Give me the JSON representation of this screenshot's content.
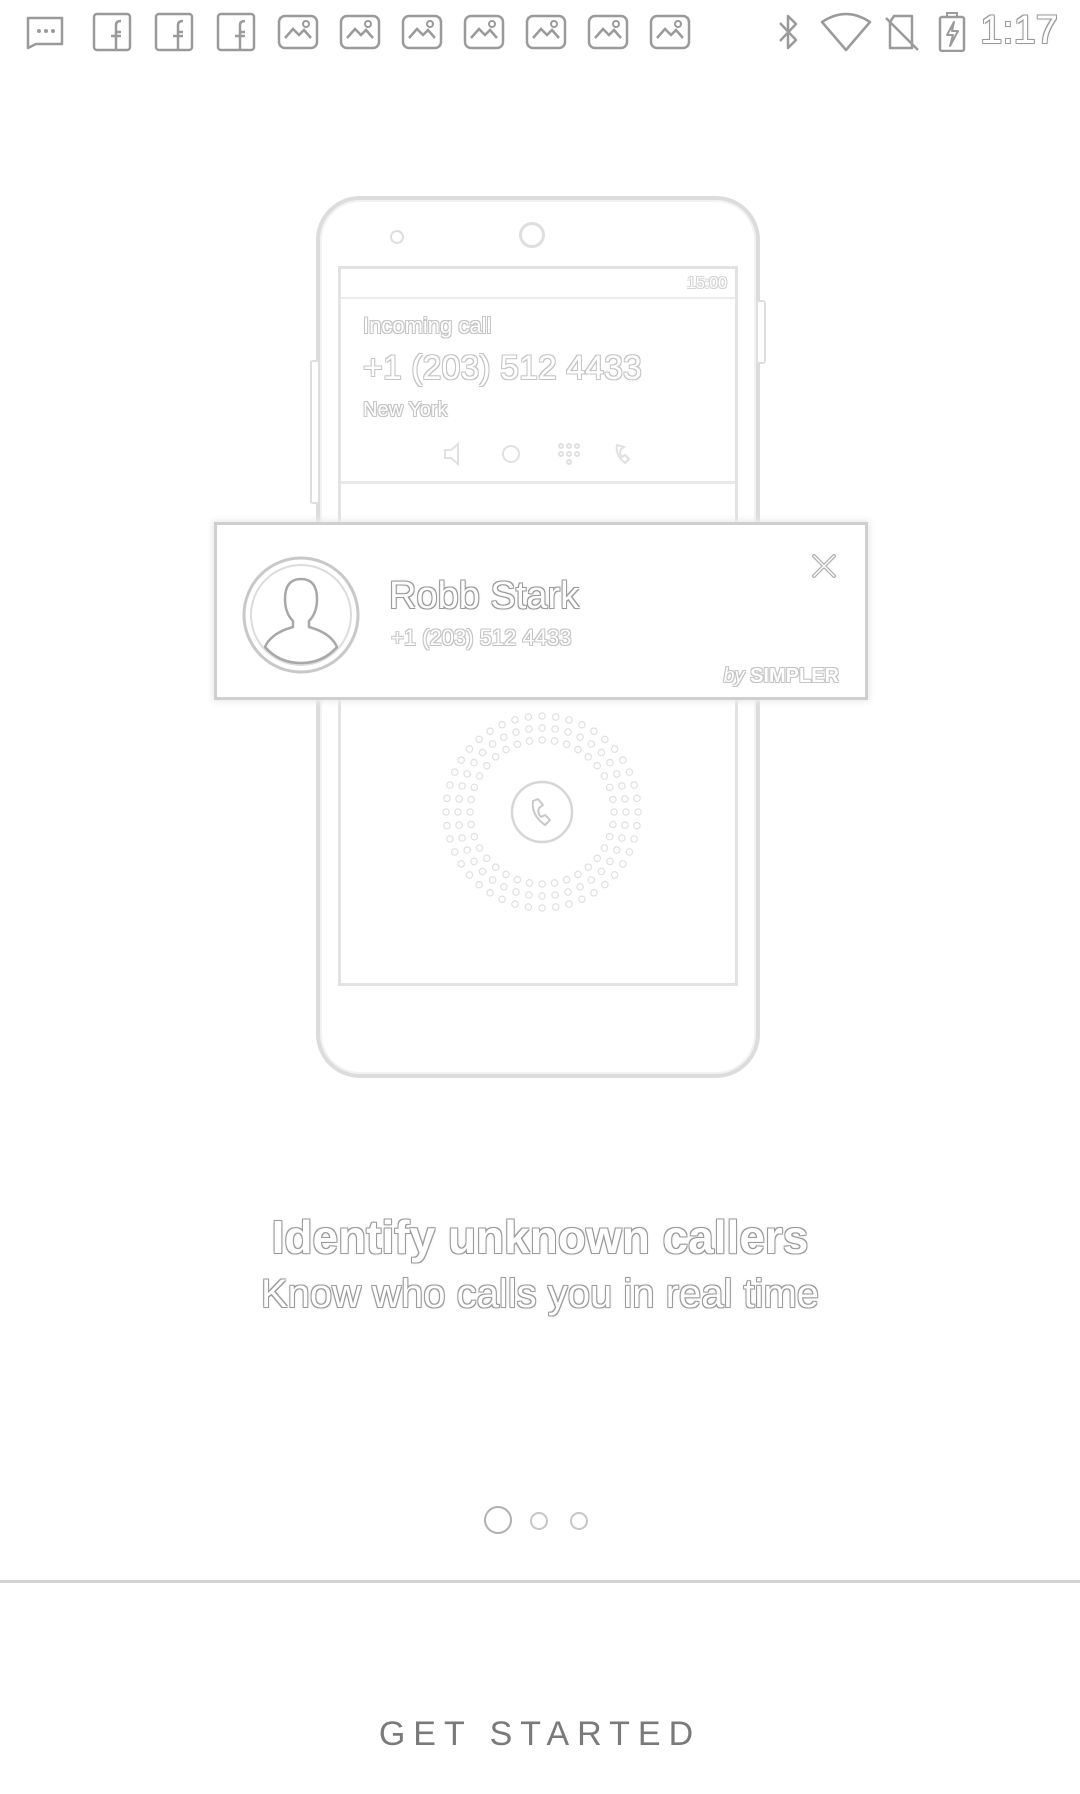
{
  "status_bar": {
    "time": "1:17",
    "notification_icons": [
      "messenger-icon",
      "facebook-icon",
      "facebook-icon",
      "facebook-icon",
      "photo-icon",
      "photo-icon",
      "photo-icon",
      "photo-icon",
      "photo-icon",
      "photo-icon",
      "photo-icon"
    ],
    "system_icons": [
      "bluetooth-icon",
      "wifi-icon",
      "no-sim-icon",
      "battery-charging-icon"
    ]
  },
  "illustration": {
    "incoming_screen": {
      "status_time": "15:00",
      "label": "Incoming call",
      "number": "+1 (203) 512 4433",
      "location": "New York"
    },
    "caller_card": {
      "name": "Robb Stark",
      "number": "+1 (203) 512 4433",
      "brand_prefix": "by",
      "brand": "SIMPLER"
    }
  },
  "onboarding": {
    "title": "Identify unknown callers",
    "subtitle": "Know who calls you in real time"
  },
  "pager": {
    "page_count": 3,
    "current_page": 1
  },
  "actions": {
    "get_started_label": "GET STARTED"
  }
}
